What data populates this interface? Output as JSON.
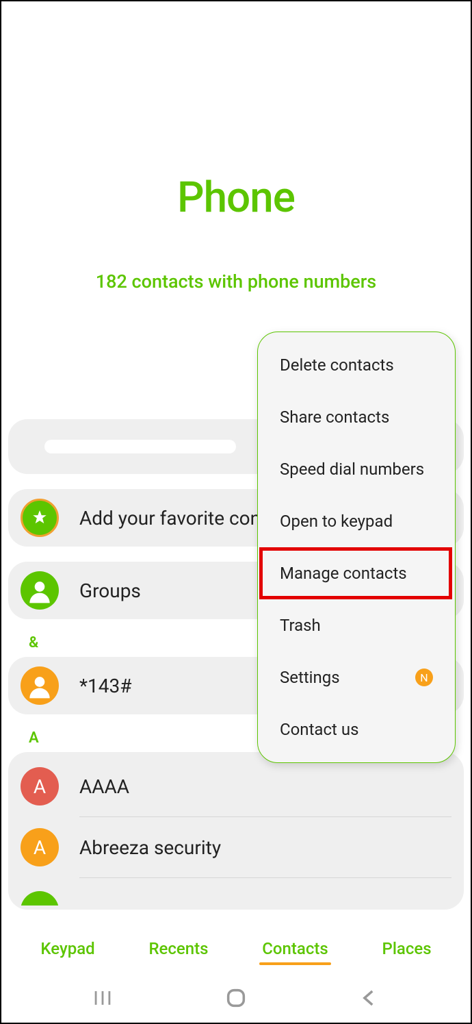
{
  "header": {
    "title": "Phone",
    "subtitle": "182 contacts with phone numbers"
  },
  "rows": {
    "favorite_label": "Add your favorite contacts",
    "groups_label": "Groups",
    "contact_143": "*143#",
    "contact_aaaa": "AAAA",
    "contact_abreeza": "Abreeza security"
  },
  "sections": {
    "amp": "&",
    "a": "A"
  },
  "avatars": {
    "aaaa_initial": "A",
    "abreeza_initial": "A"
  },
  "popup": {
    "items": {
      "delete": "Delete contacts",
      "share": "Share contacts",
      "speed": "Speed dial numbers",
      "open_keypad": "Open to keypad",
      "manage": "Manage contacts",
      "trash": "Trash",
      "settings": "Settings",
      "contact_us": "Contact us"
    },
    "badge": "N"
  },
  "tabs": {
    "keypad": "Keypad",
    "recents": "Recents",
    "contacts": "Contacts",
    "places": "Places"
  }
}
